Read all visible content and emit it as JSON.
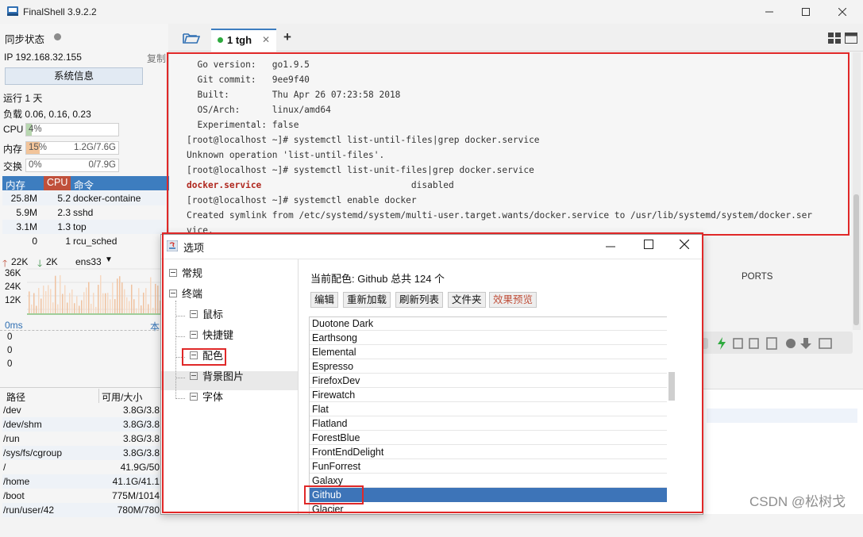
{
  "window": {
    "title": "FinalShell 3.9.2.2",
    "controls": [
      "minimize",
      "maximize",
      "close"
    ]
  },
  "sidebar": {
    "sync_label": "同步状态",
    "ip_label": "IP 192.168.32.155",
    "copy_label": "复制",
    "sysinfo_button": "系统信息",
    "uptime": "运行 1 天",
    "load": "负载 0.06, 0.16, 0.23",
    "cpu": {
      "label": "CPU",
      "value": "4%",
      "fraction": 0.04
    },
    "mem": {
      "label": "内存",
      "percent": "15%",
      "detail": "1.2G/7.6G",
      "fraction": 0.15
    },
    "swap": {
      "label": "交换",
      "percent": "0%",
      "detail": "0/7.9G",
      "fraction": 0
    },
    "process_table": {
      "headers": [
        "内存",
        "CPU",
        "命令"
      ],
      "rows": [
        {
          "mem": "25.8M",
          "cpu": "5.2",
          "cmd": "docker-containe"
        },
        {
          "mem": "5.9M",
          "cpu": "2.3",
          "cmd": "sshd"
        },
        {
          "mem": "3.1M",
          "cpu": "1.3",
          "cmd": "top"
        },
        {
          "mem": "0",
          "cpu": "1",
          "cmd": "rcu_sched"
        }
      ]
    },
    "network": {
      "up": "22K",
      "down": "2K",
      "interface": "ens33",
      "y_labels": [
        "36K",
        "24K",
        "12K"
      ]
    },
    "latency": {
      "label": "0ms",
      "right_label": "本",
      "y_labels": [
        "0",
        "0",
        "0"
      ]
    },
    "disk_table": {
      "headers": [
        "路径",
        "可用/大小"
      ],
      "rows": [
        {
          "path": "/dev",
          "size": "3.8G/3.8"
        },
        {
          "path": "/dev/shm",
          "size": "3.8G/3.8"
        },
        {
          "path": "/run",
          "size": "3.8G/3.8"
        },
        {
          "path": "/sys/fs/cgroup",
          "size": "3.8G/3.8"
        },
        {
          "path": "/",
          "size": "41.9G/50"
        },
        {
          "path": "/home",
          "size": "41.1G/41.1"
        },
        {
          "path": "/boot",
          "size": "775M/1014"
        },
        {
          "path": "/run/user/42",
          "size": "780M/780"
        }
      ]
    }
  },
  "tabs": {
    "active_tab": "1 tgh",
    "add_label": "+"
  },
  "terminal": {
    "lines": [
      {
        "text": "  Go version:   go1.9.5",
        "style": "normal"
      },
      {
        "text": "  Git commit:   9ee9f40",
        "style": "normal"
      },
      {
        "text": "  Built:        Thu Apr 26 07:23:58 2018",
        "style": "normal"
      },
      {
        "text": "  OS/Arch:      linux/amd64",
        "style": "normal"
      },
      {
        "text": "  Experimental: false",
        "style": "normal"
      },
      {
        "text": "[root@localhost ~]# systemctl list-until-files|grep docker.service",
        "style": "normal"
      },
      {
        "text": "Unknown operation 'list-until-files'.",
        "style": "normal"
      },
      {
        "text": "[root@localhost ~]# systemctl list-unit-files|grep docker.service",
        "style": "normal"
      },
      {
        "text": "docker.service",
        "style": "highlight",
        "suffix": "                            disabled"
      },
      {
        "text": "[root@localhost ~]# systemctl enable docker",
        "style": "normal"
      },
      {
        "text": "Created symlink from /etc/systemd/system/multi-user.target.wants/docker.service to /usr/lib/systemd/system/docker.ser",
        "style": "normal"
      },
      {
        "text": "vice.",
        "style": "normal"
      }
    ]
  },
  "background": {
    "ports_label": "PORTS"
  },
  "dialog": {
    "title": "选项",
    "tree": {
      "general": "常规",
      "terminal": "终端",
      "mouse": "鼠标",
      "shortcuts": "快捷键",
      "color": "配色",
      "bg_image": "背景图片",
      "font": "字体"
    },
    "current_scheme": "当前配色: Github 总共 124 个",
    "buttons": [
      "编辑",
      "重新加载",
      "刷新列表",
      "文件夹",
      "效果预览"
    ],
    "schemes": [
      "Duotone Dark",
      "Earthsong",
      "Elemental",
      "Espresso",
      "FirefoxDev",
      "Firewatch",
      "Flat",
      "Flatland",
      "ForestBlue",
      "FrontEndDelight",
      "FunForrest",
      "Galaxy",
      "Github",
      "Glacier"
    ],
    "selected_scheme": "Github"
  },
  "watermark": "CSDN @松树戈",
  "colors": {
    "accent_blue": "#3d7dbf",
    "highlight_red": "#e02828",
    "cpu_header": "#c0503b",
    "terminal_bg": "#f6f6f6"
  }
}
